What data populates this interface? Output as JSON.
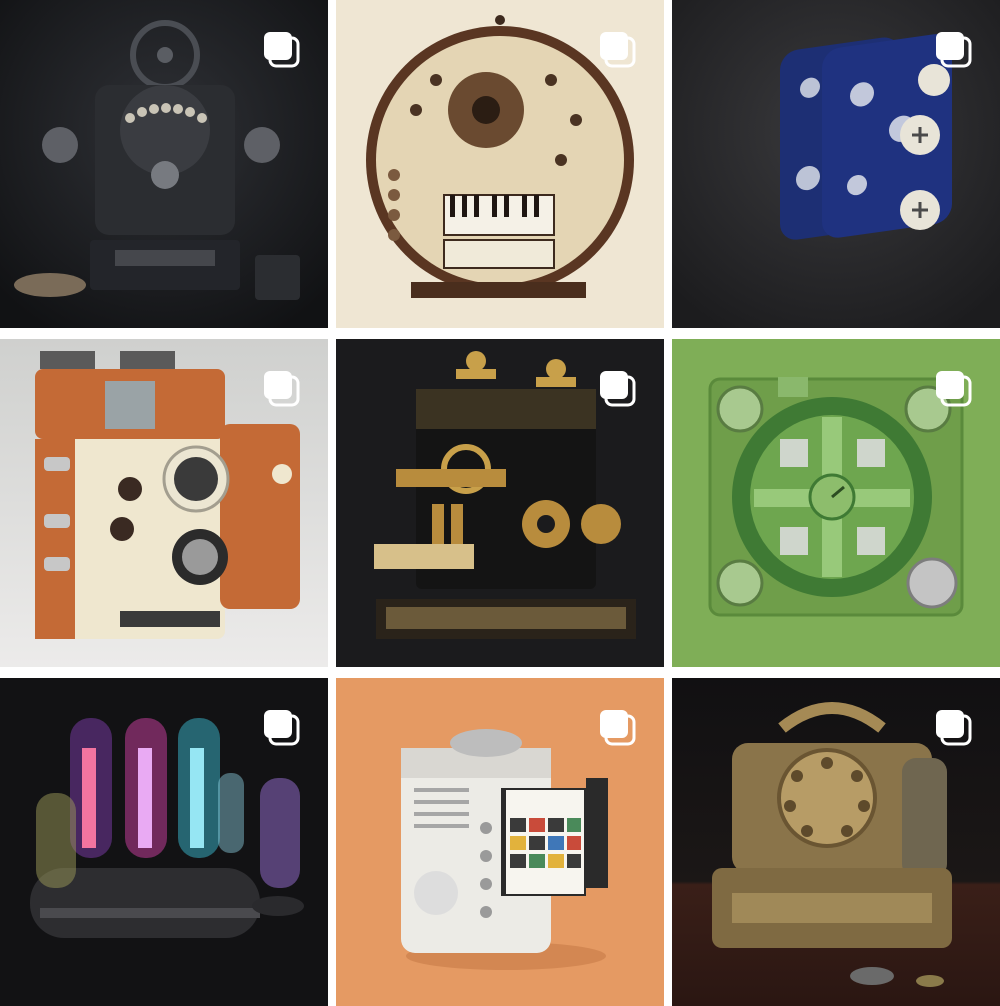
{
  "grid": {
    "item_count": 9,
    "items": [
      {
        "id": 1,
        "subject": "steampunk-typewriter-machine",
        "multiple_icon": "multiple-images-icon",
        "bg": "#1c1d20"
      },
      {
        "id": 2,
        "subject": "round-wooden-organ-machine",
        "multiple_icon": "multiple-images-icon",
        "bg": "#efe6d3"
      },
      {
        "id": 3,
        "subject": "blue-porcelain-boxes",
        "multiple_icon": "multiple-images-icon",
        "bg": "#2a2a2c"
      },
      {
        "id": 4,
        "subject": "retro-orange-camera",
        "multiple_icon": "multiple-images-icon",
        "bg": "#dfe0de"
      },
      {
        "id": 5,
        "subject": "ornate-brass-machine",
        "multiple_icon": "multiple-images-icon",
        "bg": "#1b1b1d"
      },
      {
        "id": 6,
        "subject": "green-circuit-board-device",
        "multiple_icon": "multiple-images-icon",
        "bg": "#7fae57"
      },
      {
        "id": 7,
        "subject": "vacuum-tube-device",
        "multiple_icon": "multiple-images-icon",
        "bg": "#121214"
      },
      {
        "id": 8,
        "subject": "white-cube-gadget",
        "multiple_icon": "multiple-images-icon",
        "bg": "#e59a63"
      },
      {
        "id": 9,
        "subject": "golden-antique-register",
        "multiple_icon": "multiple-images-icon",
        "bg": "#241a17"
      }
    ]
  }
}
